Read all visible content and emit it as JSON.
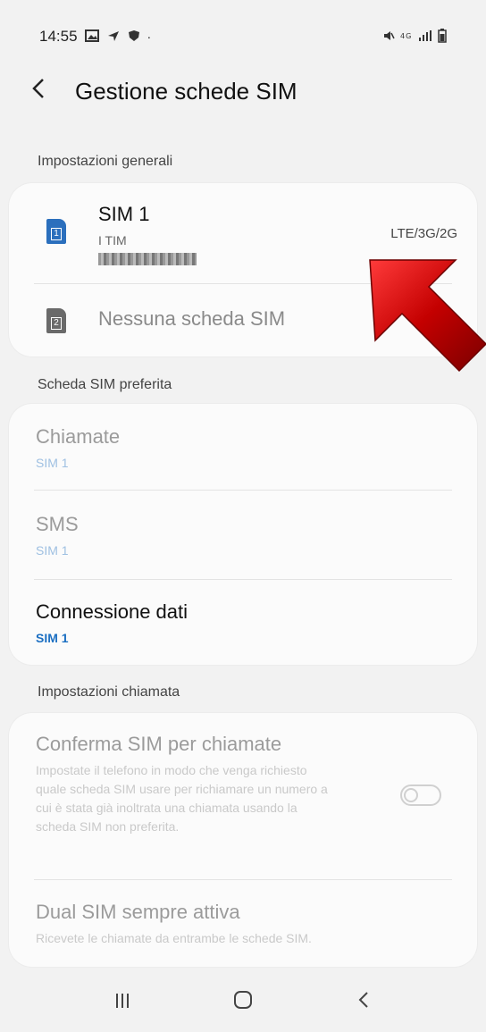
{
  "status_bar": {
    "time": "14:55",
    "left_icons": [
      "gallery-icon",
      "navigation-icon",
      "shield-icon",
      "dot-icon"
    ],
    "right_icons": [
      "mute-icon",
      "4g-icon",
      "signal-icon",
      "battery-icon"
    ]
  },
  "header": {
    "title": "Gestione schede SIM"
  },
  "sections": {
    "general": "Impostazioni generali",
    "preferred": "Scheda SIM preferita",
    "calls": "Impostazioni chiamata"
  },
  "sims": [
    {
      "name": "SIM 1",
      "operator": "I TIM",
      "network": "LTE/3G/2G",
      "slot": "1"
    },
    {
      "name": "Nessuna scheda SIM",
      "slot": "2"
    }
  ],
  "preferred": [
    {
      "title": "Chiamate",
      "value": "SIM 1",
      "enabled": false
    },
    {
      "title": "SMS",
      "value": "SIM 1",
      "enabled": false
    },
    {
      "title": "Connessione dati",
      "value": "SIM 1",
      "enabled": true
    }
  ],
  "call_settings": {
    "confirm_title": "Conferma SIM per chiamate",
    "confirm_desc": "Impostate il telefono in modo che venga richiesto quale scheda SIM usare per richiamare un numero a cui è stata già inoltrata una chiamata usando la scheda SIM non preferita.",
    "confirm_toggle": false,
    "dual_title": "Dual SIM sempre attiva",
    "dual_desc": "Ricevete le chiamate da entrambe le schede SIM."
  },
  "colors": {
    "accent": "#1b6fc2",
    "sim1": "#2b6fbd",
    "arrow": "#c40000"
  }
}
